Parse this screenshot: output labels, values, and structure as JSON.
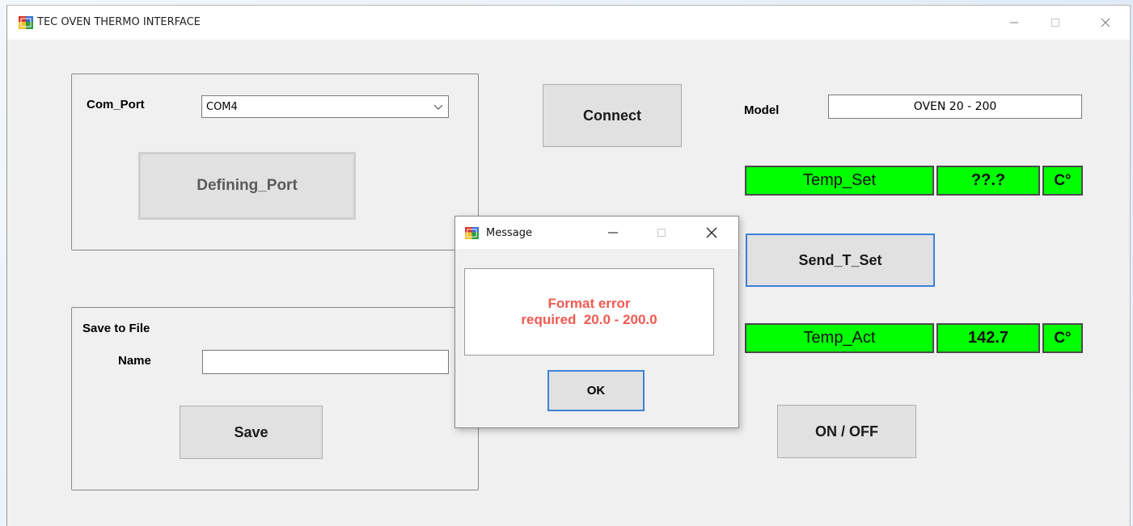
{
  "window": {
    "title": "TEC OVEN THERMO INTERFACE"
  },
  "port": {
    "label": "Com_Port",
    "selected": "COM4",
    "define_button": "Defining_Port"
  },
  "connect_button": "Connect",
  "model": {
    "label": "Model",
    "value": "OVEN 20 - 200"
  },
  "temp_set": {
    "label": "Temp_Set",
    "value": "??.?",
    "unit": "C°"
  },
  "send_button": "Send_T_Set",
  "temp_act": {
    "label": "Temp_Act",
    "value": "142.7",
    "unit": "C°"
  },
  "onoff_button": "ON / OFF",
  "save": {
    "group_label": "Save to File",
    "name_label": "Name",
    "name_value": "",
    "button": "Save"
  },
  "dialog": {
    "title": "Message",
    "line1": "Format error",
    "line2": "required  20.0 - 200.0",
    "ok": "OK"
  },
  "colors": {
    "indicator_green": "#00ff00",
    "error_text": "#f05a50",
    "focus_border": "#3c82d6"
  }
}
